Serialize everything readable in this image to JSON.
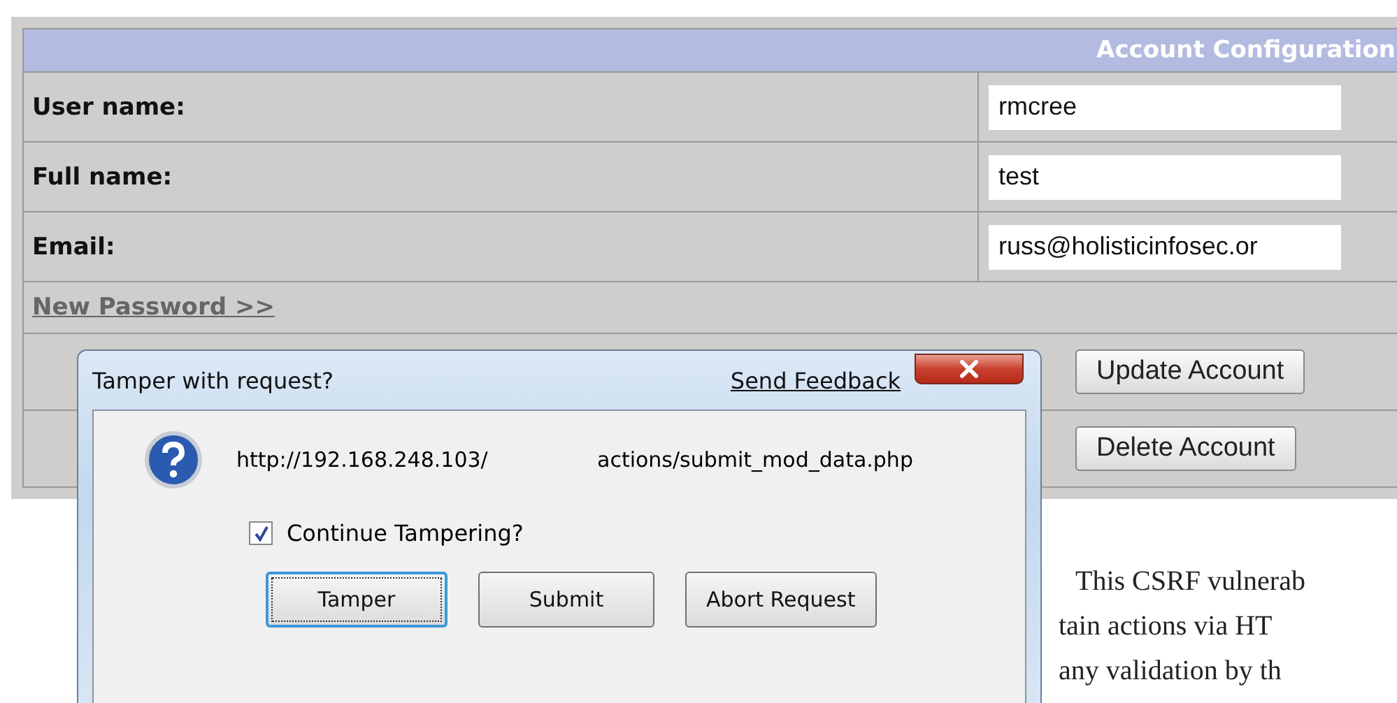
{
  "panel": {
    "title": "Account Configuration",
    "fields": [
      {
        "label": "User name:",
        "value": "rmcree"
      },
      {
        "label": "Full name:",
        "value": "test"
      },
      {
        "label": "Email:",
        "value": "russ@holisticinfosec.or"
      }
    ],
    "link": "New Password >>",
    "buttons": [
      "Update Account",
      "Delete Account"
    ]
  },
  "dialog": {
    "title": "Tamper with request?",
    "feedback": "Send Feedback",
    "url_parts": [
      "http://192.168.248.103/",
      "actions/submit_mod_data.php"
    ],
    "checkbox": {
      "label": "Continue Tampering?",
      "checked": true
    },
    "buttons": [
      {
        "label": "Tamper",
        "focused": true
      },
      {
        "label": "Submit",
        "focused": false
      },
      {
        "label": "Abort Request",
        "focused": false
      }
    ]
  },
  "body_text": [
    "This CSRF vulnerab",
    "tain actions via HT",
    "any validation by th"
  ]
}
